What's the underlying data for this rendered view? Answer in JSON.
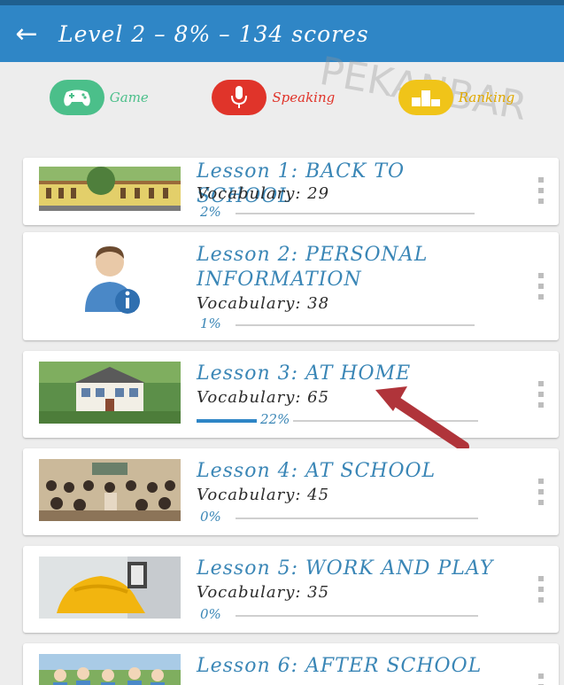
{
  "header": {
    "back_icon": "arrow-left-icon",
    "title": "Level 2 – 8% – 134 scores"
  },
  "actions": [
    {
      "label": "Game",
      "icon": "gamepad-icon",
      "color": "#4bbf8a",
      "label_color": "#4bbf8a"
    },
    {
      "label": "Speaking",
      "icon": "microphone-icon",
      "color": "#e0342a",
      "label_color": "#e0342a"
    },
    {
      "label": "Ranking",
      "icon": "podium-icon",
      "color": "#f0c419",
      "label_color": "#e0a800"
    }
  ],
  "lessons": [
    {
      "title": "Lesson 1: BACK TO SCHOOL",
      "vocabulary": "Vocabulary: 29",
      "progress_text": "2%",
      "progress": 0.02
    },
    {
      "title": "Lesson 2: PERSONAL INFORMATION",
      "vocabulary": "Vocabulary: 38",
      "progress_text": "1%",
      "progress": 0.01
    },
    {
      "title": "Lesson 3: AT HOME",
      "vocabulary": "Vocabulary: 65",
      "progress_text": "22%",
      "progress": 0.22
    },
    {
      "title": "Lesson 4: AT SCHOOL",
      "vocabulary": "Vocabulary: 45",
      "progress_text": "0%",
      "progress": 0.0
    },
    {
      "title": "Lesson 5: WORK AND PLAY",
      "vocabulary": "Vocabulary: 35",
      "progress_text": "0%",
      "progress": 0.0
    },
    {
      "title": "Lesson 6: AFTER SCHOOL",
      "vocabulary": "",
      "progress_text": "",
      "progress": 0.0
    }
  ],
  "colors": {
    "header_bg": "#2f86c6",
    "accent": "#3a86b6"
  },
  "watermark": "PEKANBAR"
}
